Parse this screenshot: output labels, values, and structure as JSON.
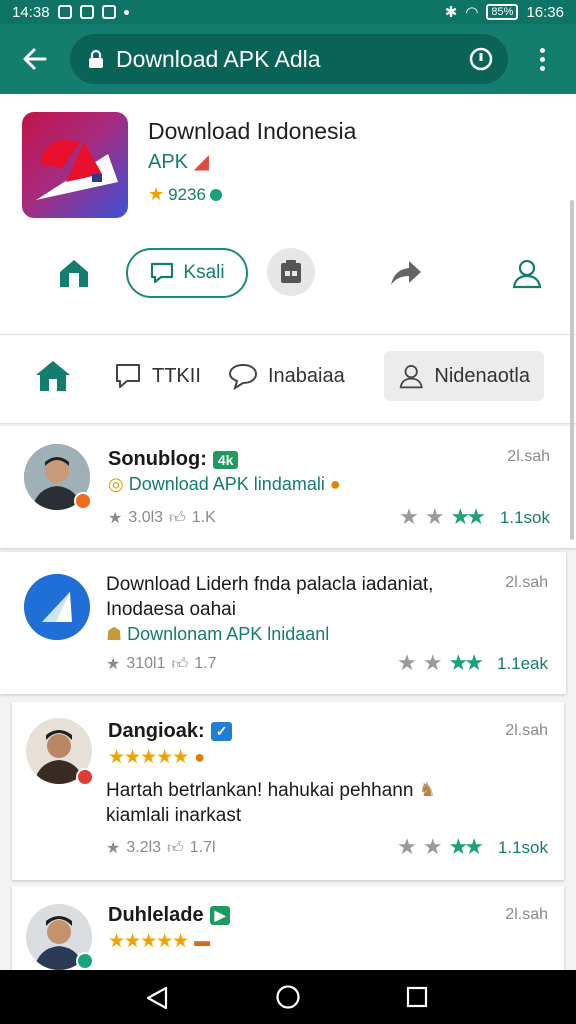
{
  "status_bar": {
    "time_left": "14:38",
    "time_right": "16:36",
    "battery": "85%"
  },
  "browser": {
    "url": "Download APK Adla"
  },
  "app": {
    "title": "Download Indonesia",
    "subtitle": "APK",
    "rating": "9236",
    "actions": {
      "comment_label": "Ksali"
    }
  },
  "filters": [
    {
      "label": "TTKII"
    },
    {
      "label": "Inabaiaa"
    },
    {
      "label": "Nidenaotla"
    }
  ],
  "posts": [
    {
      "name": "Sonublog:",
      "tag": "4k",
      "time": "2l.sah",
      "text_line1": "",
      "text_line2": "",
      "link": "Download APK lindamali",
      "stats": "3.0l3",
      "stats2": "1.K",
      "likes": "1.1sok"
    },
    {
      "name": "",
      "tag": "",
      "time": "2l.sah",
      "text_line1": "Download Liderh fnda palacla iadaniat,",
      "text_line2": "Inodaesa oahai",
      "link": "Downlonam APK lnidaanl",
      "stats": "310l1",
      "stats2": "1.7",
      "likes": "1.1eak"
    },
    {
      "name": "Dangioak:",
      "tag": "",
      "time": "2l.sah",
      "text_line1": "Hartah betrlankan! hahukai pehhann",
      "text_line2": "kiamlali inarkast",
      "link": "",
      "stats": "3.2l3",
      "stats2": "1.7l",
      "likes": "1.1sok"
    },
    {
      "name": "Duhlelade",
      "tag": "",
      "time": "2l.sah",
      "text_line1": "",
      "text_line2": "",
      "link": "",
      "stats": "",
      "stats2": "",
      "likes": ""
    }
  ],
  "colors": {
    "primary": "#137d6e",
    "status": "#0e7466",
    "star": "#f0a300"
  },
  "icons": [
    "back-arrow-icon",
    "lock-icon",
    "reload-icon",
    "more-icon",
    "home-icon",
    "chat-icon",
    "clipboard-icon",
    "share-icon",
    "profile-icon"
  ]
}
